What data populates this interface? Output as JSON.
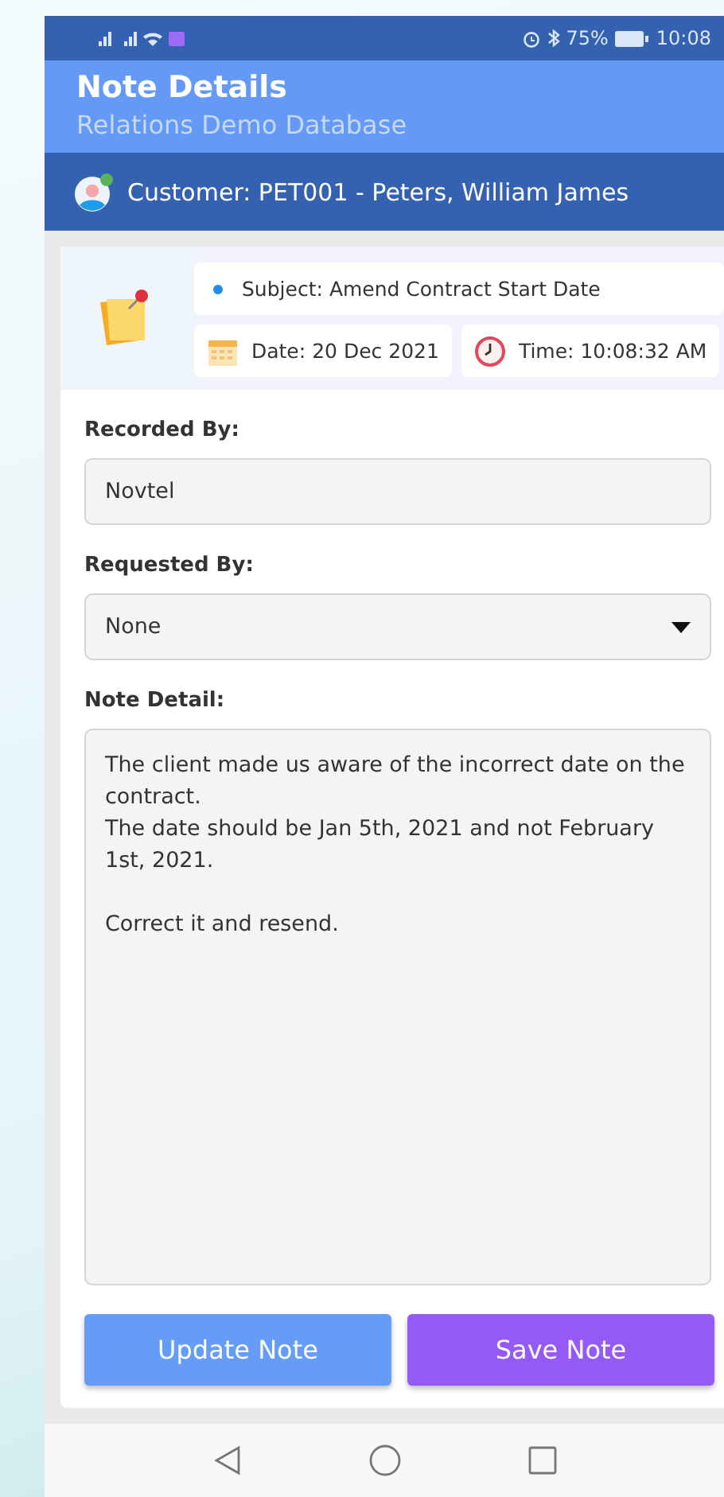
{
  "status_bar": {
    "battery": "75%",
    "time": "10:08"
  },
  "header": {
    "title": "Note Details",
    "subtitle": "Relations Demo Database"
  },
  "customer": {
    "label": "Customer: PET001 - Peters, William James"
  },
  "summary": {
    "subject_label": "Subject:",
    "subject": "Amend Contract Start Date",
    "date_label": "Date:",
    "date": "20 Dec 2021",
    "time_label": "Time:",
    "time": "10:08:32 AM"
  },
  "fields": [
    {
      "kind": "text",
      "label": "Recorded By:",
      "value": "Novtel"
    },
    {
      "kind": "select",
      "label": "Requested By:",
      "value": "None"
    },
    {
      "kind": "multiline",
      "label": "Note Detail:",
      "value": "The client made us aware of the incorrect date on the contract.\nThe date should be Jan 5th, 2021 and not February 1st, 2021.\n\nCorrect it and resend."
    }
  ],
  "buttons": [
    {
      "label": "Update Note",
      "color": "#659cf7"
    },
    {
      "label": "Save Note",
      "color": "#9559f5"
    }
  ]
}
